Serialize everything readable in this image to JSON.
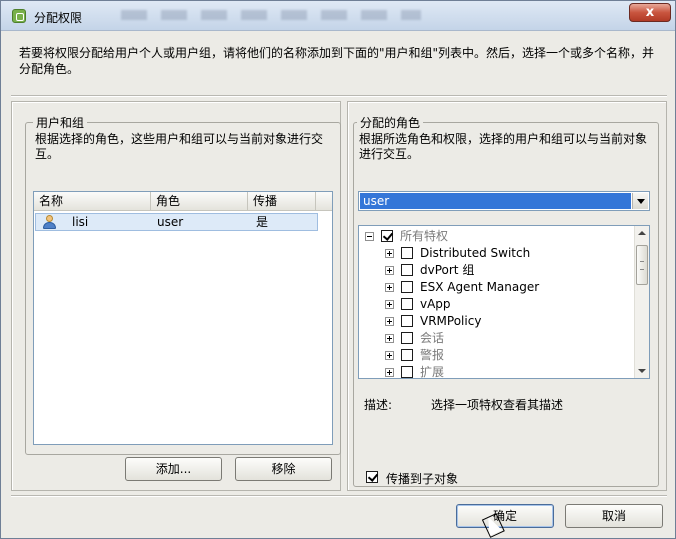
{
  "window": {
    "title": "分配权限",
    "close_label": "x"
  },
  "intro_text": "若要将权限分配给用户个人或用户组，请将他们的名称添加到下面的\"用户和组\"列表中。然后，选择一个或多个名称，并分配角色。",
  "users_panel": {
    "legend": "用户和组",
    "description": "根据选择的角色，这些用户和组可以与当前对象进行交互。",
    "columns": [
      "名称",
      "角色",
      "传播"
    ],
    "rows": [
      {
        "name": "lisi",
        "role": "user",
        "propagate": "是"
      }
    ],
    "add_button": "添加...",
    "remove_button": "移除"
  },
  "roles_panel": {
    "legend": "分配的角色",
    "description": "根据所选角色和权限，选择的用户和组可以与当前对象进行交互。",
    "role_select": "user",
    "tree": {
      "root": "所有特权",
      "items": [
        {
          "label": "Distributed Switch",
          "enabled": true
        },
        {
          "label": "dvPort 组",
          "enabled": true
        },
        {
          "label": "ESX Agent Manager",
          "enabled": true
        },
        {
          "label": "vApp",
          "enabled": true
        },
        {
          "label": "VRMPolicy",
          "enabled": true
        },
        {
          "label": "会话",
          "enabled": false
        },
        {
          "label": "警报",
          "enabled": false
        },
        {
          "label": "扩展",
          "enabled": false
        }
      ]
    },
    "description_label": "描述:",
    "description_value": "选择一项特权查看其描述",
    "propagate_label": "传播到子对象"
  },
  "footer": {
    "ok_button": "确定",
    "cancel_button": "取消"
  }
}
